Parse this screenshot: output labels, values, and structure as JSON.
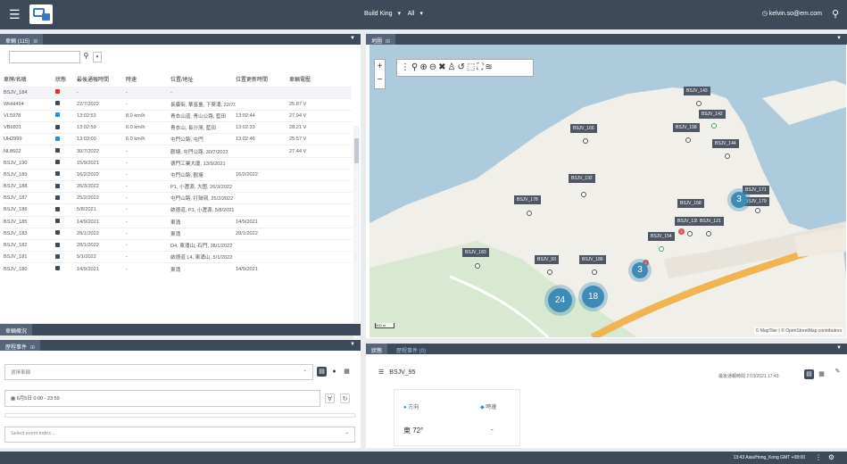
{
  "topbar": {
    "menu_icon": "hamburger-icon",
    "context": [
      "Build King",
      "All"
    ],
    "user_label": "kelvin.so@em.com",
    "search_icon": "search-icon"
  },
  "vehicle_panel": {
    "tab_label": "車輛 (115)",
    "search_placeholder": "",
    "columns": [
      "車牌/名稱",
      "狀態",
      "最後通報時間",
      "時速",
      "位置/地址",
      "位置更新時間",
      "車輛電壓"
    ],
    "rows": [
      {
        "name": "BSJV_184",
        "status": "#d9342b",
        "time": "-",
        "speed": "-",
        "addr": "-",
        "updated": "",
        "voltage": ""
      },
      {
        "name": "WHH494",
        "status": "#3d4a5a",
        "time": "22/7/2022",
        "speed": "-",
        "addr": "長康街, 華富臺, 下葵涌, 22/7/2022",
        "updated": "",
        "voltage": "25.87 V"
      },
      {
        "name": "VL5978",
        "status": "#2a8fd1",
        "time": "13:02:53",
        "speed": "8.0 km/h",
        "addr": "青衣山道, 青山公路, 藍田",
        "updated": "13:02:44",
        "voltage": "27.94 V"
      },
      {
        "name": "VB6831",
        "status": "#3d4a5a",
        "time": "13:02:59",
        "speed": "6.0 km/h",
        "addr": "青衣山, 長沙灣, 藍田",
        "updated": "13:02:33",
        "voltage": "28.21 V"
      },
      {
        "name": "UH2999",
        "status": "#2a8fd1",
        "time": "13:03:00",
        "speed": "6.0 km/h",
        "addr": "屯門公路, 屯門",
        "updated": "13:02:46",
        "voltage": "25.57 V"
      },
      {
        "name": "NL8602",
        "status": "#3d4a5a",
        "time": "30/7/2022",
        "speed": "-",
        "addr": "觀塘, 屯門公路, 30/7/2022",
        "updated": "",
        "voltage": "27.44 V"
      },
      {
        "name": "BSJV_190",
        "status": "#3d4a5a",
        "time": "15/9/2021",
        "speed": "-",
        "addr": "德門工業大廈, 13/9/2021",
        "updated": "",
        "voltage": ""
      },
      {
        "name": "BSJV_189",
        "status": "#3d4a5a",
        "time": "16/2/2022",
        "speed": "-",
        "addr": "屯門山路, 觀塘",
        "updated": "16/2/2022",
        "voltage": ""
      },
      {
        "name": "BSJV_188",
        "status": "#3d4a5a",
        "time": "26/3/2022",
        "speed": "-",
        "addr": "P1, 小瀝源, 大圍, 26/3/2022",
        "updated": "",
        "voltage": ""
      },
      {
        "name": "BSJV_187",
        "status": "#3d4a5a",
        "time": "25/2/2022",
        "speed": "-",
        "addr": "屯門山路, 打鼓嶺, 25/2/2022",
        "updated": "",
        "voltage": ""
      },
      {
        "name": "BSJV_186",
        "status": "#3d4a5a",
        "time": "5/8/2021",
        "speed": "-",
        "addr": "啟德道, P1, 小瀝源, 5/8/2021",
        "updated": "",
        "voltage": ""
      },
      {
        "name": "BSJV_185",
        "status": "#3d4a5a",
        "time": "14/9/2021",
        "speed": "-",
        "addr": "東涌",
        "updated": "14/9/2021",
        "voltage": ""
      },
      {
        "name": "BSJV_183",
        "status": "#3d4a5a",
        "time": "28/1/2022",
        "speed": "-",
        "addr": "東涌",
        "updated": "28/1/2022",
        "voltage": ""
      },
      {
        "name": "BSJV_182",
        "status": "#3d4a5a",
        "time": "28/1/2022",
        "speed": "-",
        "addr": "D4, 東涌山, 石門, 28/1/2022",
        "updated": "",
        "voltage": ""
      },
      {
        "name": "BSJV_181",
        "status": "#3d4a5a",
        "time": "5/1/2022",
        "speed": "-",
        "addr": "啟德道 L4, 東涌山, 5/1/2022",
        "updated": "",
        "voltage": ""
      },
      {
        "name": "BSJV_180",
        "status": "#3d4a5a",
        "time": "14/9/2021",
        "speed": "-",
        "addr": "東涌",
        "updated": "14/9/2021",
        "voltage": ""
      }
    ]
  },
  "collapsed_tab": "車輛概況",
  "events_panel": {
    "tab_label": "歷程事件",
    "vehicle_select_placeholder": "選擇車輛",
    "date_range": "6月5日 0:00 - 23:59",
    "event_select_placeholder": "Select event index..."
  },
  "map_panel": {
    "tab_label": "地圖",
    "attribution": "© MapTiler | © OpenStreetMap contributors",
    "scale_label": "500 m",
    "labels": [
      {
        "text": "BSJV_143"
      },
      {
        "text": "BSJV_142"
      },
      {
        "text": "BSJV_158"
      },
      {
        "text": "BSJV_144"
      },
      {
        "text": "BSJV_166"
      },
      {
        "text": "BSJV_192"
      },
      {
        "text": "BSJV_178"
      },
      {
        "text": "BSJV_171"
      },
      {
        "text": "BSJV_179"
      },
      {
        "text": "BSJV_158"
      },
      {
        "text": "BSJV_135"
      },
      {
        "text": "BSJV_121"
      },
      {
        "text": "BSJV_154"
      },
      {
        "text": "BSJV_183"
      },
      {
        "text": "BSJV_93"
      },
      {
        "text": "BSJV_186"
      }
    ],
    "clusters": [
      "3",
      "3",
      "24",
      "18"
    ],
    "badges": [
      "2",
      "4"
    ]
  },
  "detail_panel": {
    "tabs": [
      "狀態",
      "歷程事件 (0)"
    ],
    "vehicle_name": "BSJV_95",
    "last_update": "最後通報時間 27/3/2021 17:43",
    "cards": [
      {
        "label": "方向",
        "value": "東 72°"
      },
      {
        "label": "時速",
        "value": "-"
      }
    ]
  },
  "status_bar": {
    "timezone": "13:43 Asia/Hong_Kong GMT +08:00"
  },
  "colors": {
    "header": "#3d4a5a",
    "accent": "#3a78c3",
    "cluster": "#3e8cb5",
    "road": "#f1b453"
  }
}
